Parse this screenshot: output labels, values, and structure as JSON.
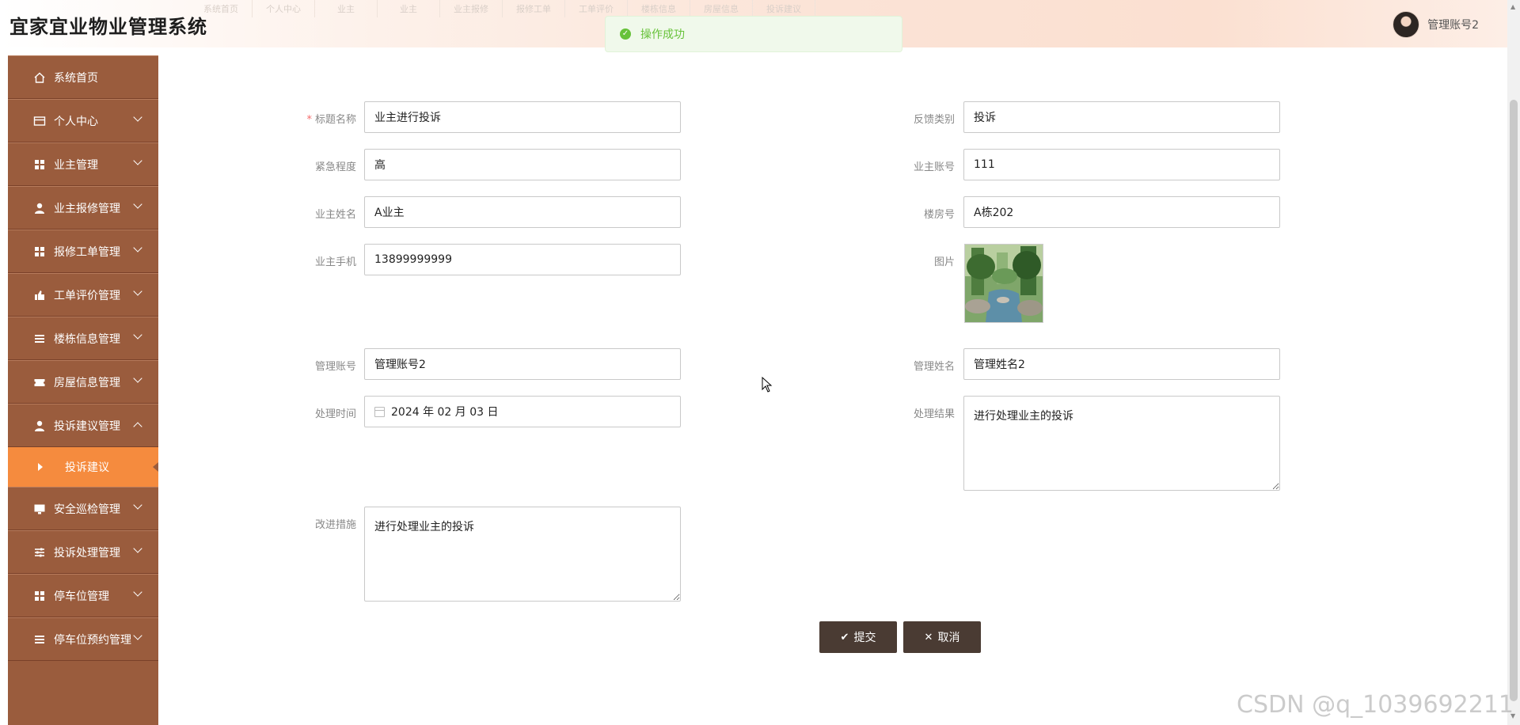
{
  "app": {
    "title": "宜家宜业物业管理系统"
  },
  "top_nav": [
    "系统首页",
    "个人中心",
    "业主",
    "业主",
    "业主报修",
    "报修工单",
    "工单评价",
    "楼栋信息",
    "房屋信息",
    "投诉建议"
  ],
  "toast": {
    "message": "操作成功",
    "color": "#67c23a"
  },
  "user": {
    "name": "管理账号2"
  },
  "sidebar": {
    "items": [
      {
        "label": "系统首页",
        "icon": "home-icon",
        "has_children": false
      },
      {
        "label": "个人中心",
        "icon": "card-icon",
        "has_children": true
      },
      {
        "label": "业主管理",
        "icon": "grid-icon",
        "has_children": true
      },
      {
        "label": "业主报修管理",
        "icon": "person-icon",
        "has_children": true
      },
      {
        "label": "报修工单管理",
        "icon": "grid-icon",
        "has_children": true
      },
      {
        "label": "工单评价管理",
        "icon": "thumb-icon",
        "has_children": true
      },
      {
        "label": "楼栋信息管理",
        "icon": "list-icon",
        "has_children": true
      },
      {
        "label": "房屋信息管理",
        "icon": "ticket-icon",
        "has_children": true
      },
      {
        "label": "投诉建议管理",
        "icon": "person-icon",
        "has_children": true,
        "expanded": true
      },
      {
        "label": "安全巡检管理",
        "icon": "monitor-icon",
        "has_children": true
      },
      {
        "label": "投诉处理管理",
        "icon": "sliders-icon",
        "has_children": true
      },
      {
        "label": "停车位管理",
        "icon": "grid-icon",
        "has_children": true
      },
      {
        "label": "停车位预约管理",
        "icon": "list-icon",
        "has_children": true
      }
    ],
    "active_sub": "投诉建议",
    "colors": {
      "bg": "#9a5c3d",
      "active": "#f58b3e"
    }
  },
  "form": {
    "title_label": "标题名称",
    "title_value": "业主进行投诉",
    "feedback_type_label": "反馈类别",
    "feedback_type_value": "投诉",
    "urgency_label": "紧急程度",
    "urgency_value": "高",
    "owner_account_label": "业主账号",
    "owner_account_value": "111",
    "owner_name_label": "业主姓名",
    "owner_name_value": "A业主",
    "room_label": "楼房号",
    "room_value": "A栋202",
    "owner_phone_label": "业主手机",
    "owner_phone_value": "13899999999",
    "image_label": "图片",
    "admin_account_label": "管理账号",
    "admin_account_value": "管理账号2",
    "admin_name_label": "管理姓名",
    "admin_name_value": "管理姓名2",
    "process_time_label": "处理时间",
    "process_time_value": "2024 年 02 月 03 日",
    "process_result_label": "处理结果",
    "process_result_value": "进行处理业主的投诉",
    "improvement_label": "改进措施",
    "improvement_value": "进行处理业主的投诉"
  },
  "actions": {
    "submit": "提交",
    "cancel": "取消"
  },
  "watermark": "CSDN @q_1039692211"
}
